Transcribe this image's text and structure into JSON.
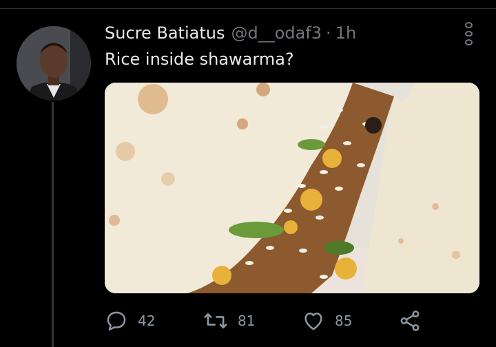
{
  "tweet": {
    "author": {
      "display_name": "Sucre Batiatus",
      "handle": "@d__odaf3",
      "separator": "·",
      "time": "1h"
    },
    "text": "Rice inside shawarma?"
  },
  "actions": {
    "reply_count": "42",
    "retweet_count": "81",
    "like_count": "85"
  },
  "icons": [
    "more-options-icon",
    "reply-icon",
    "retweet-icon",
    "like-icon",
    "share-icon"
  ],
  "colors": {
    "background": "#000000",
    "primary_text": "#e7e9ea",
    "secondary_text": "#71767b",
    "divider": "#2f3336"
  }
}
